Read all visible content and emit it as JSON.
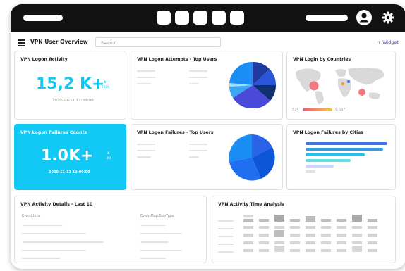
{
  "header": {
    "page_title": "VPN User Overview",
    "search_placeholder": "Search",
    "add_widget_label": "+ Widget"
  },
  "cards": {
    "logon_activity": {
      "title": "VPN Logon Activity",
      "value": "15,2 K+",
      "delta": "-5916",
      "timestamp": "2020-11-11 12:00:00"
    },
    "attempts_top_users": {
      "title": "VPN Logon Attempts - Top Users"
    },
    "login_by_countries": {
      "title": "VPN Login by Countries",
      "legend_min": "574",
      "legend_max": "9,837"
    },
    "failures_counts": {
      "title": "VPN Logon Failures Counts",
      "value": "1.0K+",
      "delta": "-94",
      "timestamp": "2020-11-11 12:00:00"
    },
    "failures_top_users": {
      "title": "VPN Logon Failures - Top Users"
    },
    "failures_by_cities": {
      "title": "VPN Logon Failures by Cities"
    },
    "activity_details": {
      "title": "VPN Activity Details - Last 10",
      "col1": "Event.Info",
      "col2": "EventMap.SubType"
    },
    "activity_time": {
      "title": "VPN Activity Time Analysis"
    }
  },
  "colors": {
    "accent_cyan": "#12c9f5",
    "accent_blue": "#2f6ee6",
    "link": "#3a46e6"
  },
  "icons": [
    "menu-icon",
    "user-icon",
    "gear-icon"
  ]
}
